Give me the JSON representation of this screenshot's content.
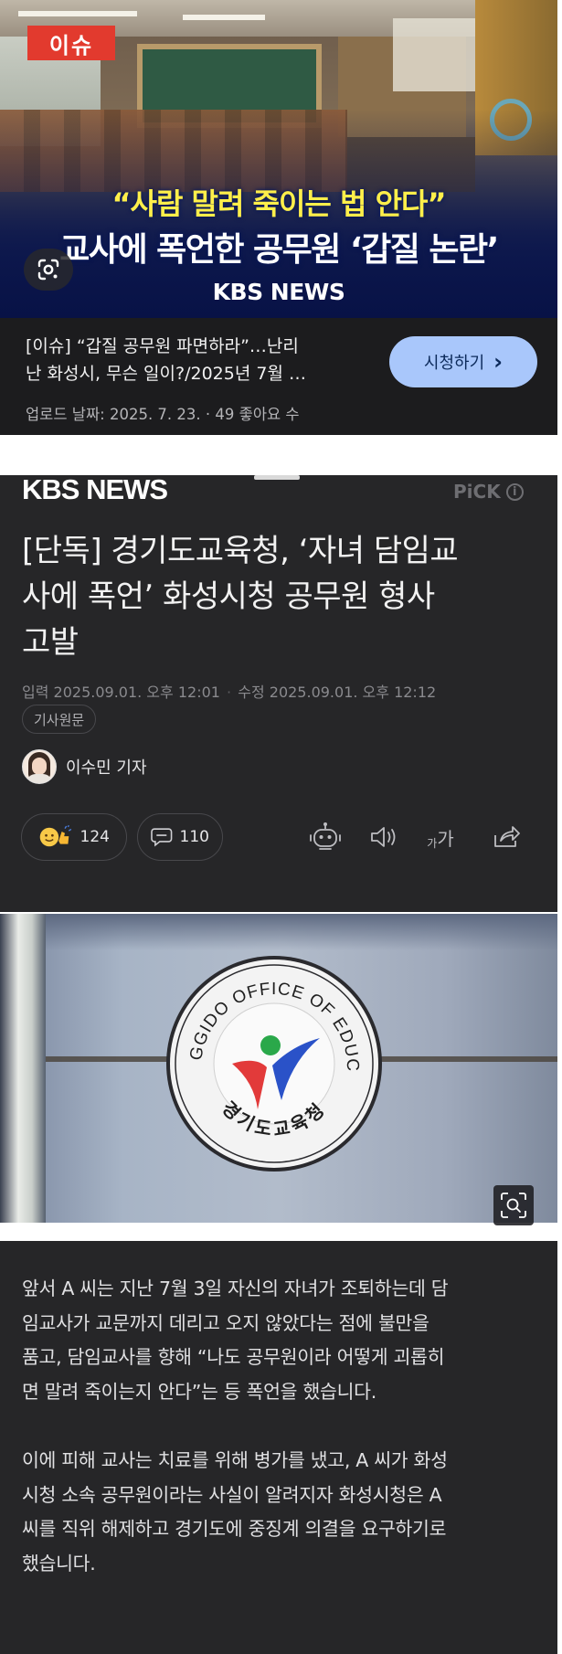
{
  "video_card": {
    "badge": "이슈",
    "headline_line1": "“사람 말려 죽이는 법 안다”",
    "headline_line2": "교사에 폭언한 공무원 ‘갑질 논란’",
    "thumb_brand": "KBS NEWS",
    "title_line1": "[이슈] “갑질 공무원 파면하라”…난리",
    "title_line2": "난 화성시, 무슨 일이?/2025년 7월 …",
    "meta": "업로드 날짜: 2025. 7. 23. · 49 좋아요 수",
    "watch_label": "시청하기",
    "watch_chevron": "›",
    "lens_icon": "google-lens-icon"
  },
  "article": {
    "brand": "KBS NEWS",
    "pick_label": "PiCK",
    "pick_info_symbol": "i",
    "title_lines": [
      "[단독] 경기도교육청, ‘자녀 담임교",
      "사에 폭언’ 화성시청 공무원 형사",
      "고발"
    ],
    "input_date": "입력 2025.09.01. 오후 12:01",
    "date_separator": "·",
    "edit_date": "수정 2025.09.01. 오후 12:12",
    "source_chip": "기사원문",
    "reporter": "이수민 기자",
    "reaction_count": "124",
    "comment_count": "110",
    "toolbar_icons": [
      "robot-summary-icon",
      "speaker-icon",
      "font-size-icon",
      "share-icon"
    ],
    "font_size_glyph_small": "가",
    "font_size_glyph_large": "가"
  },
  "photo": {
    "emblem_top_text": "GYEONGGIDO OFFICE OF EDUCATION",
    "emblem_bottom_text": "경기도교육청",
    "zoom_icon": "zoom-icon"
  },
  "body": {
    "paragraph1": [
      "앞서 A 씨는 지난 7월 3일 자신의 자녀가 조퇴하는데 담",
      "임교사가 교문까지 데리고 오지 않았다는 점에 불만을",
      "품고, 담임교사를 향해 “나도 공무원이라 어떻게 괴롭히",
      "면 말려 죽이는지 안다”는 등 폭언을 했습니다."
    ],
    "paragraph2": [
      "이에 피해 교사는 치료를 위해 병가를 냈고, A 씨가 화성",
      "시청 소속 공무원이라는 사실이 알려지자 화성시청은 A",
      "씨를 직위 해제하고 경기도에 중징계 의결을 요구하기로",
      "했습니다."
    ]
  },
  "colors": {
    "dark_bg": "#262628",
    "badge_red": "#e23a2e",
    "headline_yellow": "#ffef4a",
    "watch_button": "#a9c7fb"
  }
}
